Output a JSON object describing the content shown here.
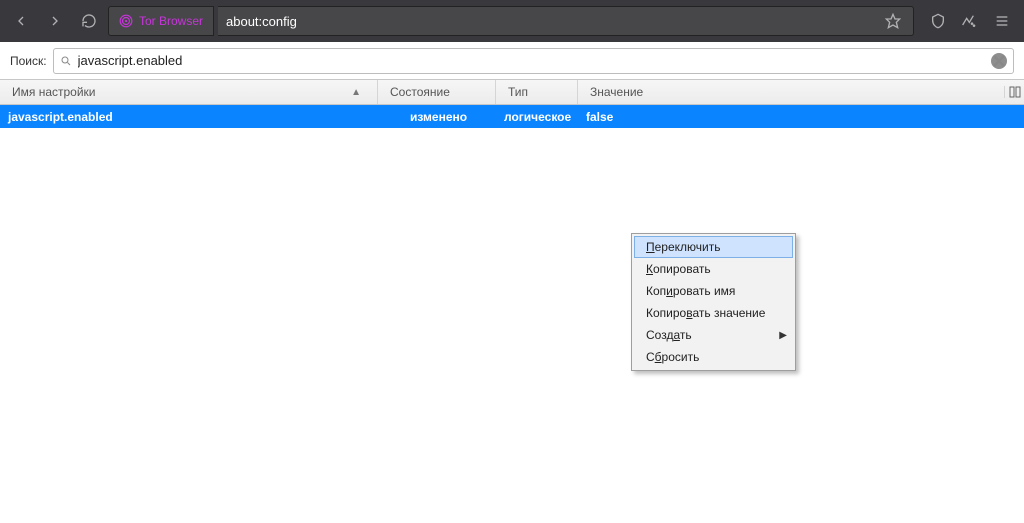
{
  "chrome": {
    "identity_label": "Tor Browser",
    "url": "about:config"
  },
  "search": {
    "label": "Поиск:",
    "value": "javascript.enabled"
  },
  "columns": {
    "name": "Имя настройки",
    "state": "Состояние",
    "type": "Тип",
    "value": "Значение"
  },
  "row": {
    "name": "javascript.enabled",
    "state": "изменено",
    "type": "логическое",
    "value": "false"
  },
  "context_menu": {
    "toggle": "Переключить",
    "copy": "Копировать",
    "copy_name": "Копировать имя",
    "copy_value": "Копировать значение",
    "create": "Создать",
    "reset": "Сбросить"
  }
}
